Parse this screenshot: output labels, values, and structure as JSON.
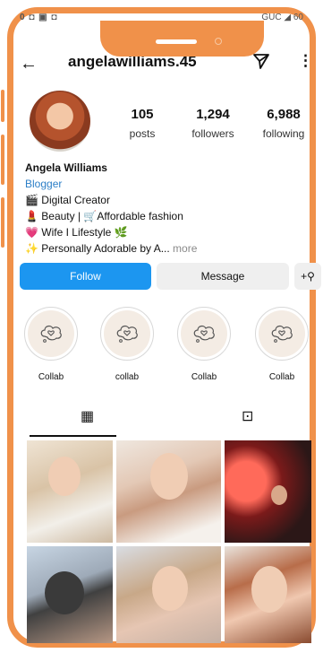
{
  "status_bar": {
    "left": "0 ◘ ▣ ◘",
    "right": "GUC ◢ 60"
  },
  "header": {
    "username": "angelawilliams.45"
  },
  "stats": [
    {
      "value": "105",
      "label": "posts"
    },
    {
      "value": "1,294",
      "label": "followers"
    },
    {
      "value": "6,988",
      "label": "following"
    }
  ],
  "bio": {
    "name": "Angela Williams",
    "category": "Blogger",
    "lines": [
      "🎬 Digital Creator",
      "💄 Beauty | 🛒Affordable fashion",
      "💗 Wife I Lifestyle 🌿",
      "✨ Personally Adorable by A..."
    ],
    "more": "more"
  },
  "buttons": {
    "follow": "Follow",
    "message": "Message",
    "add_person": "+⚲"
  },
  "highlights": [
    {
      "label": "Collab"
    },
    {
      "label": "collab"
    },
    {
      "label": "Collab"
    },
    {
      "label": "Collab"
    }
  ],
  "tabs": {
    "grid_icon": "▦",
    "tagged_icon": "⊡"
  },
  "colors": {
    "frame": "#f0914a",
    "follow": "#1c96f0",
    "link": "#2c7fc7"
  }
}
